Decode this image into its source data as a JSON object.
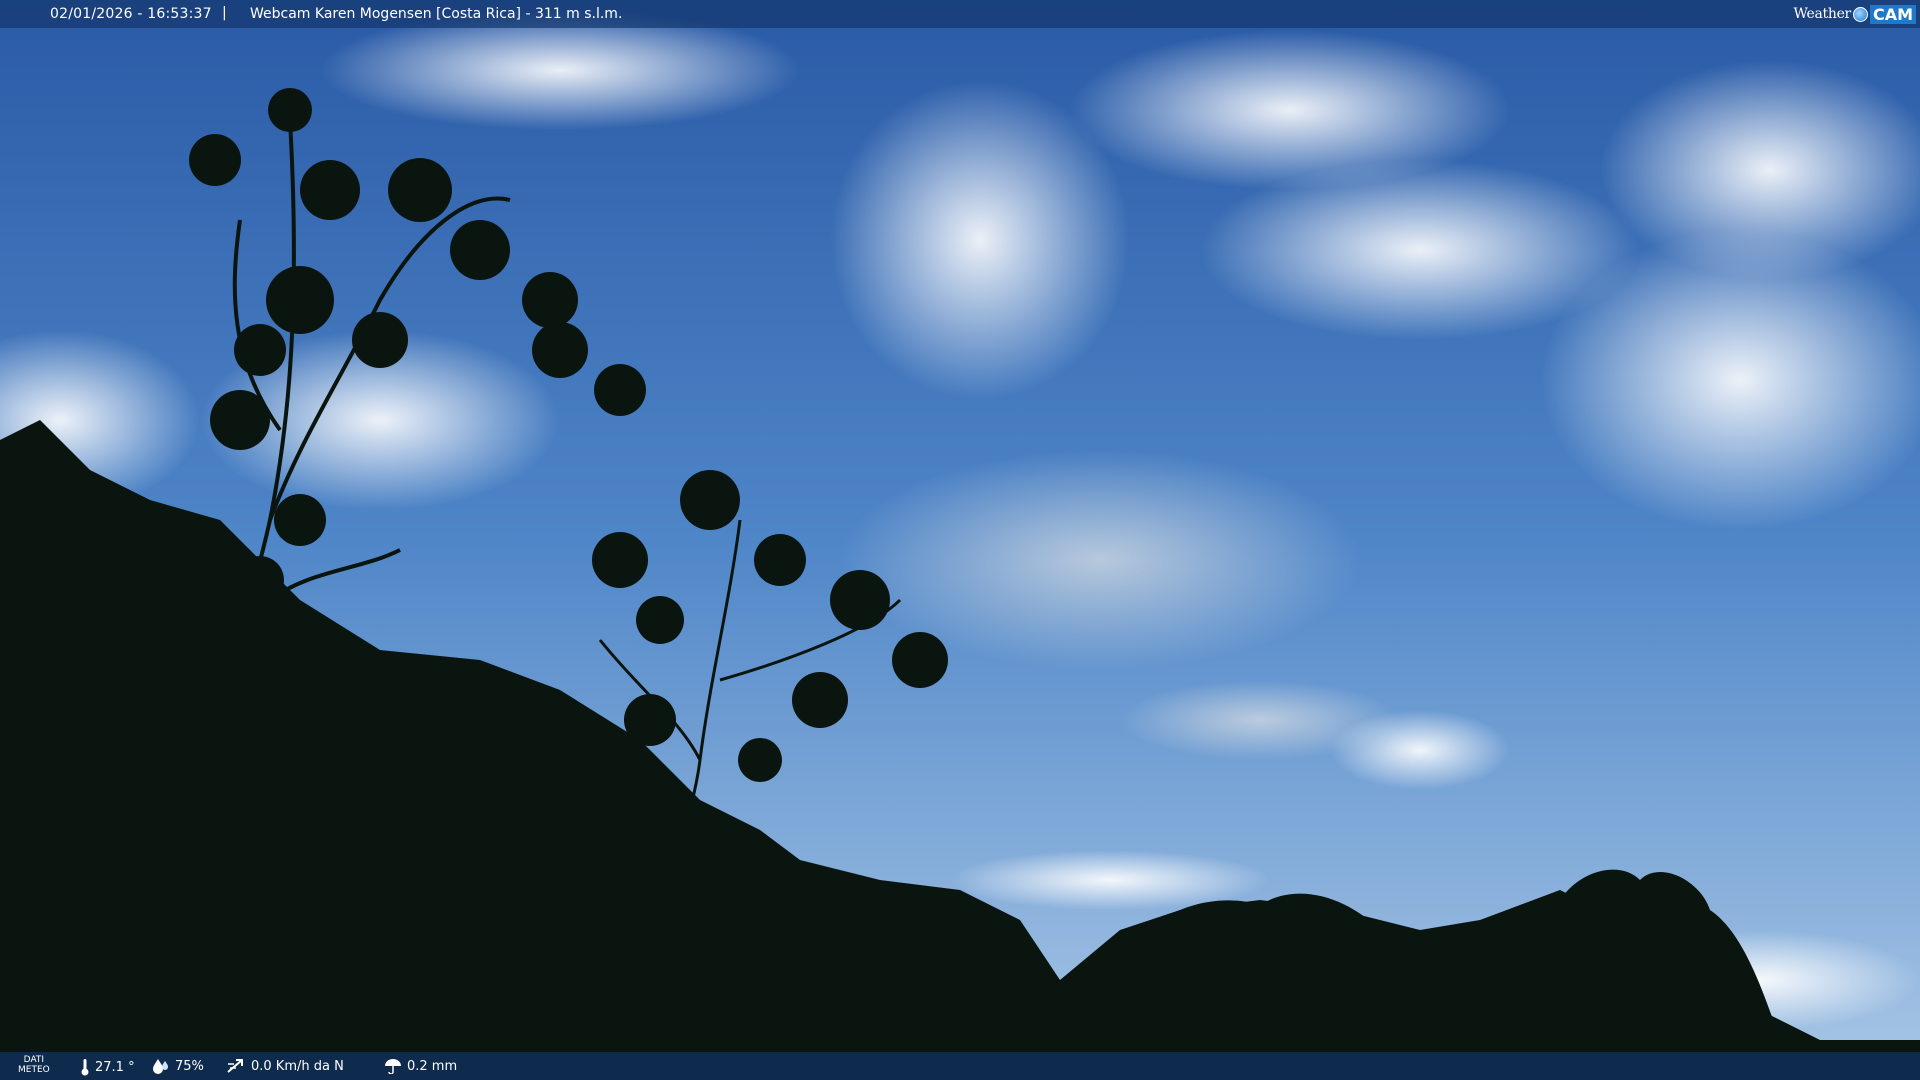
{
  "topbar": {
    "timestamp": "02/01/2026 - 16:53:37",
    "separator": "|",
    "title": "Webcam Karen Mogensen [Costa Rica]  - 311 m s.l.m."
  },
  "logo": {
    "word": "Weather",
    "cam": "CAM"
  },
  "weather": {
    "label_line1": "DATI",
    "label_line2": "METEO",
    "temperature": "27.1 °",
    "humidity": "75%",
    "wind": "0.0 Km/h da N",
    "rain": "0.2 mm"
  },
  "icons": {
    "temperature": "thermometer-icon",
    "humidity": "humidity-drop-icon",
    "wind": "wind-icon",
    "rain": "rain-umbrella-icon"
  },
  "colors": {
    "sky_top": "#2a5aa6",
    "sky_bottom": "#a9c7e6",
    "foliage": "#0b1510",
    "bar": "#143870"
  }
}
